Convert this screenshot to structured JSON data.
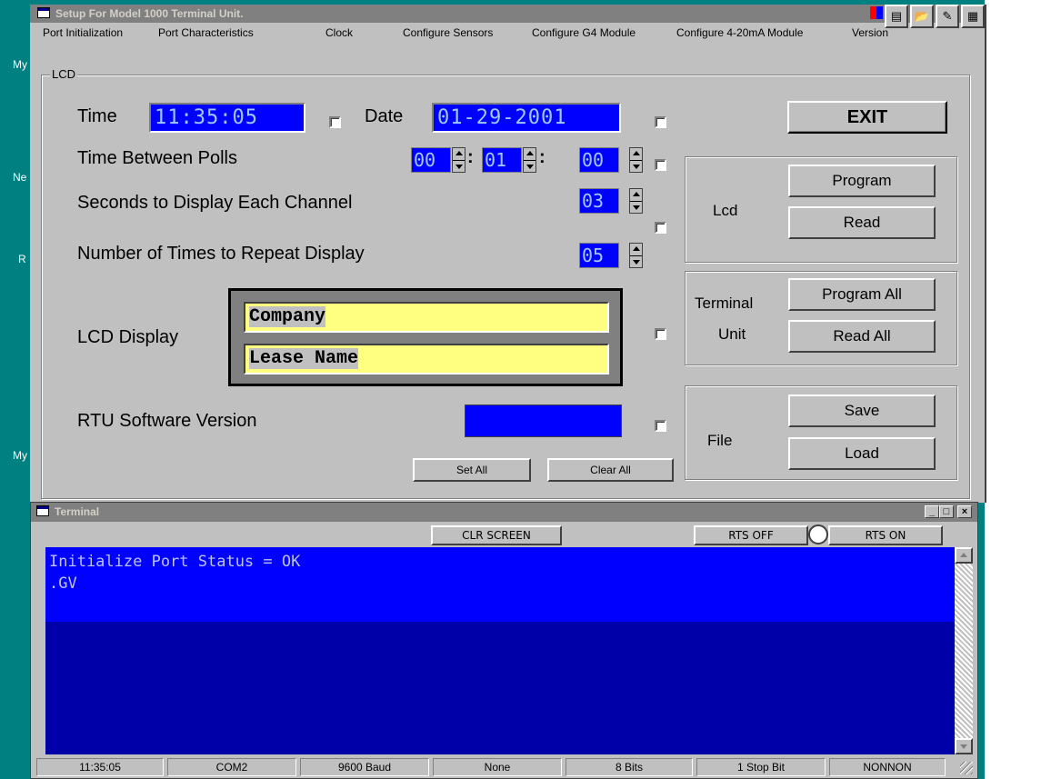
{
  "desktop": {
    "labels": [
      "My",
      "Ne",
      "R",
      "My"
    ],
    "background_color": "#008080"
  },
  "main_window": {
    "title": "Setup For Model 1000 Terminal Unit.",
    "menu": [
      "Port Initialization",
      "Port Characteristics",
      "Clock",
      "Configure Sensors",
      "Configure G4 Module",
      "Configure 4-20mA Module",
      "Version"
    ],
    "group_label": "LCD",
    "time_label": "Time",
    "time_value": "11:35:05",
    "date_label": "Date",
    "date_value": "01-29-2001",
    "exit_label": "EXIT",
    "polls_label": "Time Between Polls",
    "polls_hours": "00",
    "polls_minutes": "01",
    "polls_seconds": "00",
    "seconds_display_label": "Seconds to Display Each Channel",
    "seconds_display_value": "03",
    "repeat_label": "Number of Times to Repeat Display",
    "repeat_value": "05",
    "lcd_display_label": "LCD Display",
    "lcd_line1": "Company",
    "lcd_line2": "Lease Name",
    "rtu_version_label": "RTU Software Version",
    "rtu_version_value": "",
    "set_all": "Set All",
    "clear_all": "Clear All",
    "lcd_panel": {
      "label": "Lcd",
      "program": "Program",
      "read": "Read"
    },
    "terminal_panel": {
      "label_line1": "Terminal",
      "label_line2": "Unit",
      "program_all": "Program All",
      "read_all": "Read All"
    },
    "file_panel": {
      "label": "File",
      "save": "Save",
      "load": "Load"
    }
  },
  "terminal_window": {
    "title": "Terminal",
    "clr_screen": "CLR SCREEN",
    "rts_off": "RTS OFF",
    "rts_on": "RTS ON",
    "lines": [
      "Initialize Port Status = OK",
      ".GV"
    ],
    "status": [
      "11:35:05",
      "COM2",
      "9600 Baud",
      "None",
      "8 Bits",
      "1 Stop Bit",
      "NONNON"
    ],
    "controls": {
      "minimize": "_",
      "maximize": "□",
      "close": "×"
    }
  }
}
